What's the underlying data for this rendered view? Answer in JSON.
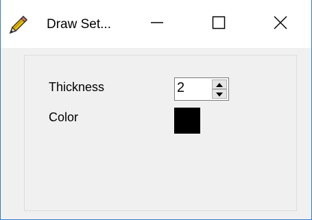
{
  "window": {
    "title": "Draw Set...",
    "icon": "pencil-icon"
  },
  "titlebar": {
    "minimize_icon": "minimize-icon",
    "maximize_icon": "maximize-icon",
    "close_icon": "close-icon"
  },
  "settings": {
    "thickness_label": "Thickness",
    "thickness_value": "2",
    "color_label": "Color",
    "color_value": "#000000"
  },
  "colors": {
    "window_border": "#2b78c9",
    "background": "#f0f0f0",
    "titlebar": "#ffffff"
  }
}
